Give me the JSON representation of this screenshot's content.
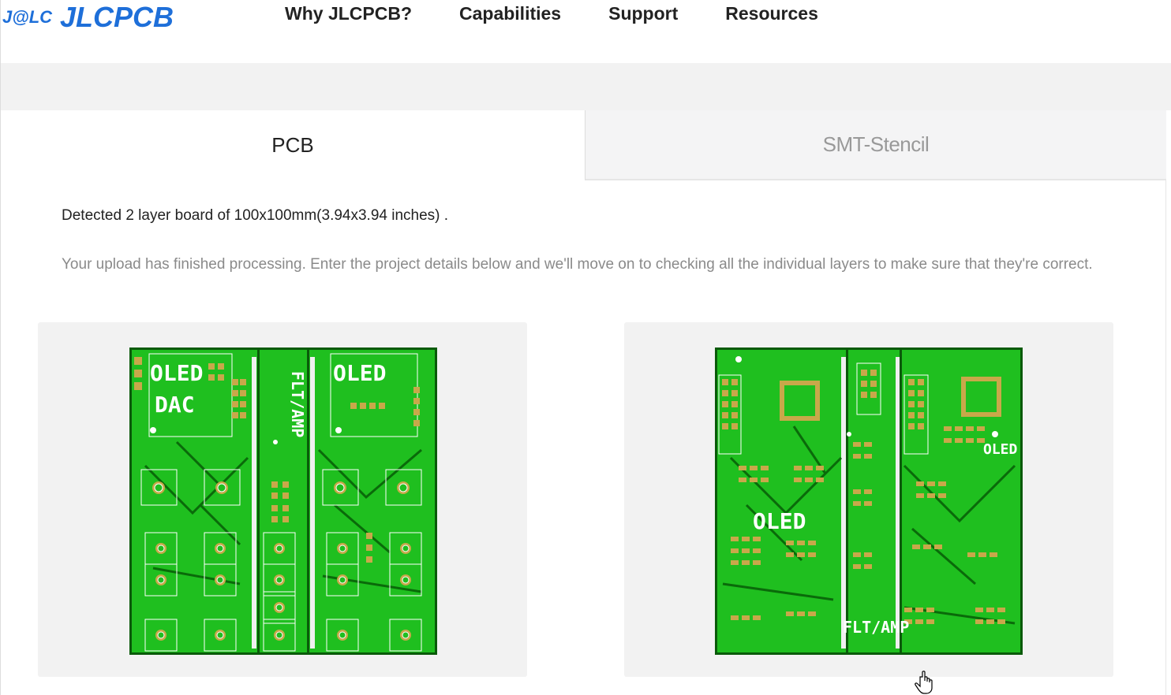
{
  "header": {
    "logo_badge": "J@LC",
    "logo_text": "JLCPCB",
    "nav": [
      "Why JLCPCB?",
      "Capabilities",
      "Support",
      "Resources"
    ]
  },
  "tabs": {
    "pcb": "PCB",
    "smt": "SMT-Stencil"
  },
  "main": {
    "detected": "Detected 2 layer board of 100x100mm(3.94x3.94 inches) .",
    "description": "Your upload has finished processing. Enter the project details below and we'll move on to checking all the individual layers to make sure that they're correct."
  },
  "boards": {
    "top": {
      "labels": [
        "OLED",
        "DAC",
        "FLT/AMP",
        "OLED"
      ]
    },
    "bottom": {
      "labels": [
        "OLED",
        "OLED",
        "FLT/AMP"
      ]
    }
  },
  "colors": {
    "brand": "#1e6fd9",
    "pcb_green": "#1fbf1f",
    "pcb_dark": "#0a5a0a",
    "pad_gold": "#c8a84a"
  }
}
